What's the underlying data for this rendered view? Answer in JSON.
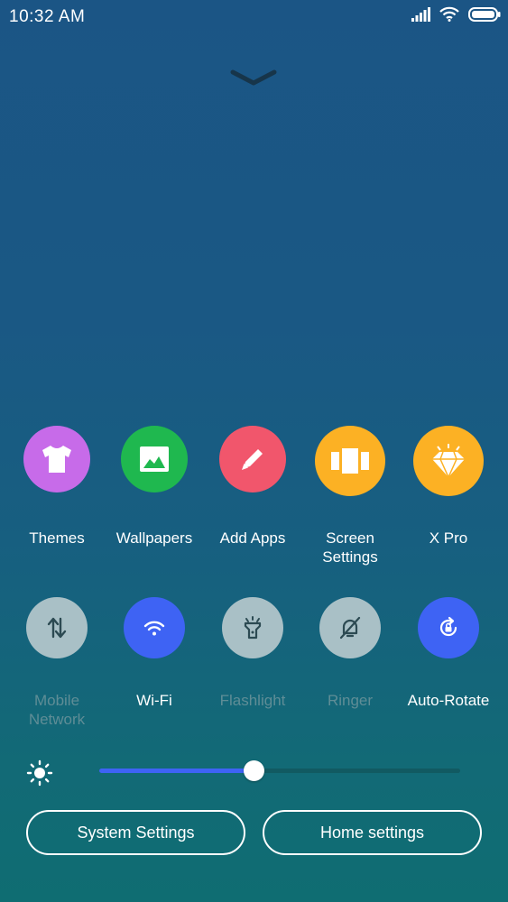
{
  "status_bar": {
    "time": "10:32  AM",
    "icons": [
      "signal-icon",
      "wifi-icon",
      "battery-icon"
    ]
  },
  "shortcuts": [
    {
      "label": "Themes",
      "icon": "shirt-icon",
      "color": "#c76be9"
    },
    {
      "label": "Wallpapers",
      "icon": "image-icon",
      "color": "#1fb84f"
    },
    {
      "label": "Add Apps",
      "icon": "pencil-icon",
      "color": "#f1566c"
    },
    {
      "label": "Screen\nSettings",
      "icon": "panels-icon",
      "color": "#fcb124"
    },
    {
      "label": "X Pro",
      "icon": "diamond-icon",
      "color": "#fcb124"
    }
  ],
  "toggles": [
    {
      "label": "Mobile\nNetwork",
      "icon": "data-arrows-icon",
      "state": "off"
    },
    {
      "label": "Wi-Fi",
      "icon": "wifi-icon",
      "state": "on"
    },
    {
      "label": "Flashlight",
      "icon": "flashlight-icon",
      "state": "off"
    },
    {
      "label": "Ringer",
      "icon": "bell-muted-icon",
      "state": "off"
    },
    {
      "label": "Auto-Rotate",
      "icon": "rotate-lock-icon",
      "state": "on"
    }
  ],
  "brightness": {
    "level": 0.43,
    "icon": "sun-icon"
  },
  "buttons": {
    "system_settings": "System Settings",
    "home_settings": "Home settings"
  },
  "colors": {
    "accent": "#3e63f4",
    "toggle_off": "#a9c0c6",
    "disabled_text": "#5f8d96"
  }
}
